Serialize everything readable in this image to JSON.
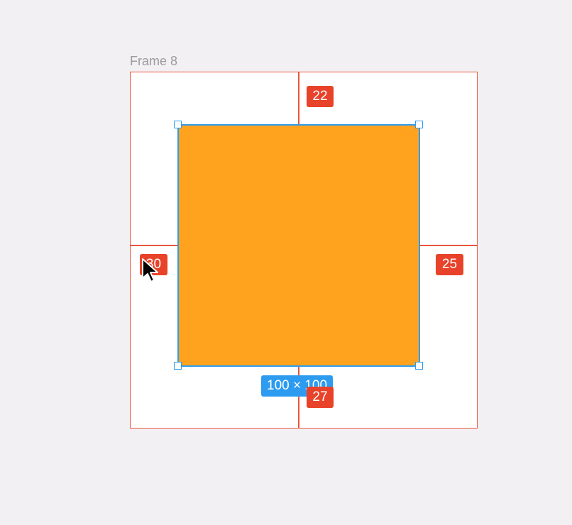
{
  "frame": {
    "name": "Frame 8"
  },
  "shape": {
    "fill_color": "#ffa31f",
    "size_label": "100 × 100"
  },
  "spacing": {
    "top": "22",
    "left": "30",
    "right": "25",
    "bottom": "27"
  },
  "colors": {
    "canvas_bg": "#f2f0f3",
    "spacing_guide": "#e8553c",
    "selection": "#2d9cf0"
  },
  "cursor": {
    "icon": "arrow-cursor-icon"
  }
}
